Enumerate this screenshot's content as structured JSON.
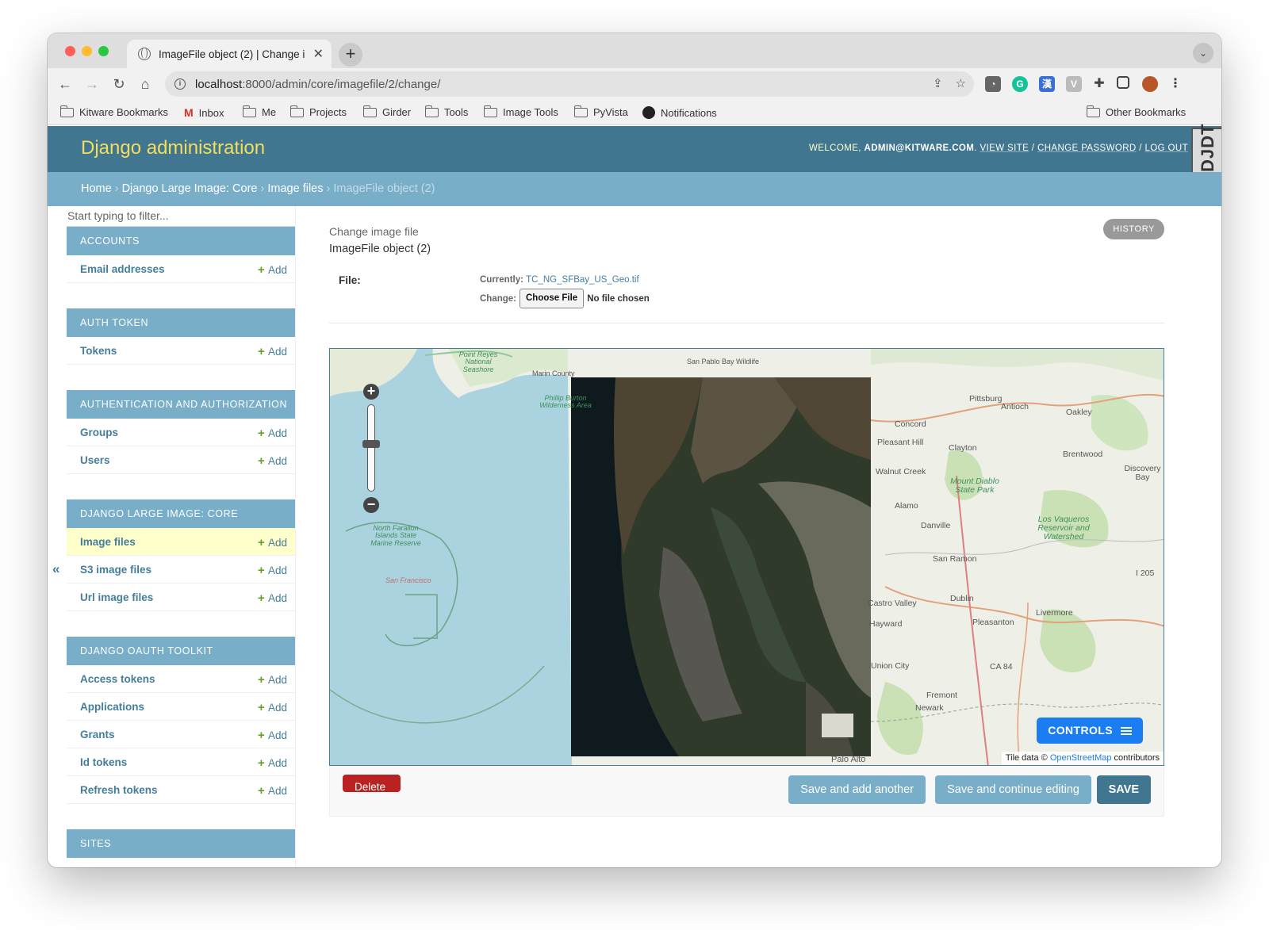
{
  "browser": {
    "tab_title": "ImageFile object (2) | Change i",
    "url_host": "localhost",
    "url_rest": ":8000/admin/core/imagefile/2/change/",
    "bookmarks": [
      "Kitware Bookmarks",
      "Inbox",
      "Me",
      "Projects",
      "Girder",
      "Tools",
      "Image Tools",
      "PyVista",
      "Notifications"
    ],
    "other_bookmarks": "Other Bookmarks"
  },
  "header": {
    "branding": "Django administration",
    "welcome": "WELCOME,",
    "user": "ADMIN@KITWARE.COM",
    "view_site": "VIEW SITE",
    "change_password": "CHANGE PASSWORD",
    "log_out": "LOG OUT",
    "separator": " / ",
    "djdt": "DJDT"
  },
  "breadcrumbs": {
    "home": "Home",
    "app": "Django Large Image: Core",
    "model": "Image files",
    "current": "ImageFile object (2)",
    "separator": " › "
  },
  "sidebar": {
    "filter_placeholder": "Start typing to filter...",
    "add_label": "Add",
    "collapse_glyph": "«",
    "modules": [
      {
        "caption": "ACCOUNTS",
        "rows": [
          "Email addresses"
        ]
      },
      {
        "caption": "AUTH TOKEN",
        "rows": [
          "Tokens"
        ]
      },
      {
        "caption": "AUTHENTICATION AND AUTHORIZATION",
        "rows": [
          "Groups",
          "Users"
        ]
      },
      {
        "caption": "DJANGO LARGE IMAGE: CORE",
        "rows": [
          "Image files",
          "S3 image files",
          "Url image files"
        ],
        "current_row": 0
      },
      {
        "caption": "DJANGO OAUTH TOOLKIT",
        "rows": [
          "Access tokens",
          "Applications",
          "Grants",
          "Id tokens",
          "Refresh tokens"
        ]
      },
      {
        "caption": "SITES",
        "rows": []
      }
    ]
  },
  "content": {
    "subtitle": "Change image file",
    "object_title": "ImageFile object (2)",
    "history_label": "HISTORY",
    "file_label": "File:",
    "currently_label": "Currently:",
    "current_file": "TC_NG_SFBay_US_Geo.tif",
    "change_label": "Change:",
    "choose_file": "Choose File",
    "no_file": "No file chosen"
  },
  "map": {
    "controls_label": "CONTROLS",
    "attribution_prefix": "Tile data © ",
    "attribution_link": "OpenStreetMap",
    "attribution_suffix": " contributors",
    "palo_alto": "Palo Alto",
    "zoom_level": 0.55,
    "place_labels": [
      "Point Reyes National Seashore",
      "Marin County",
      "San Pablo Bay Wildlife",
      "Antioch",
      "Oakley",
      "Concord",
      "Pittsburg",
      "Pleasant Hill",
      "Clayton",
      "Walnut Creek",
      "Brentwood",
      "Discovery Bay",
      "Mount Diablo State Park",
      "Alamo",
      "Danville",
      "Los Vaqueros Reservoir and Watershed",
      "San Ramon",
      "Dublin",
      "Livermore",
      "Pleasanton",
      "Castro Valley",
      "Hayward",
      "Union City",
      "Fremont",
      "Newark",
      "North Farallon Islands State Marine Reserve",
      "San Francisco",
      "Phillip Burton Wilderness Area",
      "I 205",
      "CA 84"
    ]
  },
  "actions": {
    "delete": "Delete",
    "save_add_another": "Save and add another",
    "save_continue": "Save and continue editing",
    "save": "SAVE"
  }
}
